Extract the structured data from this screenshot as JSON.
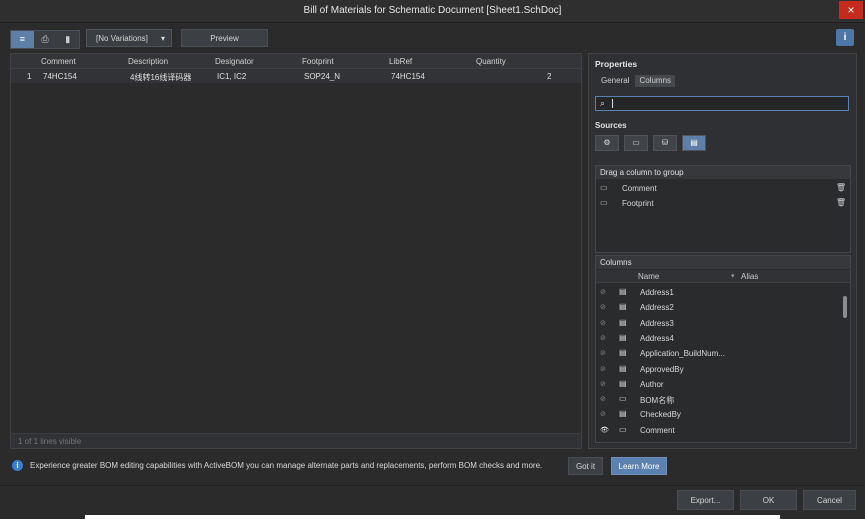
{
  "window": {
    "title": "Bill of Materials for Schematic Document [Sheet1.SchDoc]",
    "close_icon": "×"
  },
  "toolbar": {
    "view_modes": [
      "≡",
      "⎙",
      "▮"
    ],
    "variation": "[No Variations]",
    "preview_label": "Preview",
    "info_label": "i"
  },
  "grid": {
    "columns": [
      "Comment",
      "Description",
      "Designator",
      "Footprint",
      "LibRef",
      "Quantity"
    ],
    "rows": [
      {
        "index": "1",
        "comment": "74HC154",
        "description": "4线转16线译码器",
        "designator": "IC1, IC2",
        "footprint": "SOP24_N",
        "libref": "74HC154",
        "quantity": "2"
      }
    ],
    "status": "1 of 1 lines visible"
  },
  "properties": {
    "title": "Properties",
    "tabs": [
      "General",
      "Columns"
    ],
    "search_placeholder": "",
    "sources_label": "Sources",
    "sources": [
      "⚙",
      "▭",
      "⛁",
      "▤"
    ],
    "group_panel_title": "Drag a column to group",
    "group_items": [
      "Comment",
      "Footprint"
    ],
    "columns_panel_title": "Columns",
    "columns_header": {
      "name": "Name",
      "alias": "Alias"
    },
    "columns": [
      {
        "name": "Address1",
        "visible": false,
        "type": "doc"
      },
      {
        "name": "Address2",
        "visible": false,
        "type": "doc"
      },
      {
        "name": "Address3",
        "visible": false,
        "type": "doc"
      },
      {
        "name": "Address4",
        "visible": false,
        "type": "doc"
      },
      {
        "name": "Application_BuildNum...",
        "visible": false,
        "type": "doc"
      },
      {
        "name": "ApprovedBy",
        "visible": false,
        "type": "doc"
      },
      {
        "name": "Author",
        "visible": false,
        "type": "doc"
      },
      {
        "name": "BOM名称",
        "visible": false,
        "type": "part"
      },
      {
        "name": "CheckedBy",
        "visible": false,
        "type": "doc"
      },
      {
        "name": "Comment",
        "visible": true,
        "type": "part"
      }
    ]
  },
  "banner": {
    "message": "Experience greater BOM editing capabilities with ActiveBOM you can manage alternate parts and replacements, perform BOM checks and more.",
    "got_it": "Got it",
    "learn_more": "Learn More"
  },
  "footer": {
    "export": "Export...",
    "ok": "OK",
    "cancel": "Cancel"
  },
  "colors": {
    "accent": "#5b81b0",
    "close": "#c42b1c",
    "background": "#2b2b2b"
  }
}
